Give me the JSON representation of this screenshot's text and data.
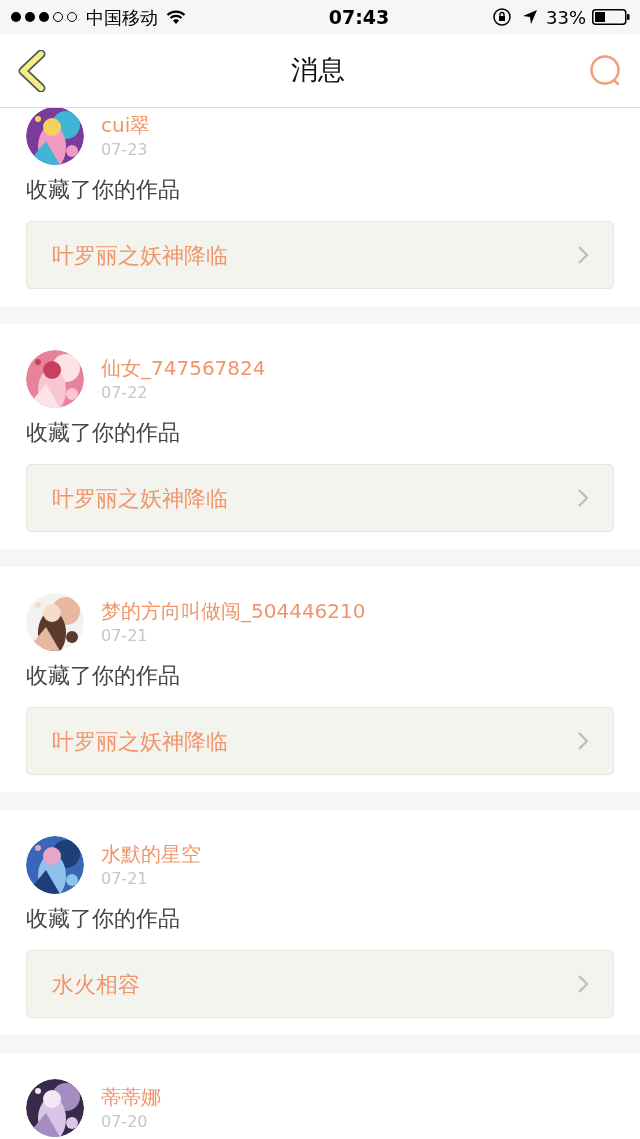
{
  "status_bar": {
    "carrier": "中国移动",
    "time": "07:43",
    "battery": "33%"
  },
  "header": {
    "title": "消息"
  },
  "messages": [
    {
      "name": "cui翠",
      "date": "07-23",
      "action": "收藏了你的作品",
      "work": "叶罗丽之妖神降临"
    },
    {
      "name": "仙女_747567824",
      "date": "07-22",
      "action": "收藏了你的作品",
      "work": "叶罗丽之妖神降临"
    },
    {
      "name": "梦的方向叫做闯_504446210",
      "date": "07-21",
      "action": "收藏了你的作品",
      "work": "叶罗丽之妖神降临"
    },
    {
      "name": "水默的星空",
      "date": "07-21",
      "action": "收藏了你的作品",
      "work": "水火相容"
    },
    {
      "name": "蒂蒂娜",
      "date": "07-20"
    }
  ]
}
